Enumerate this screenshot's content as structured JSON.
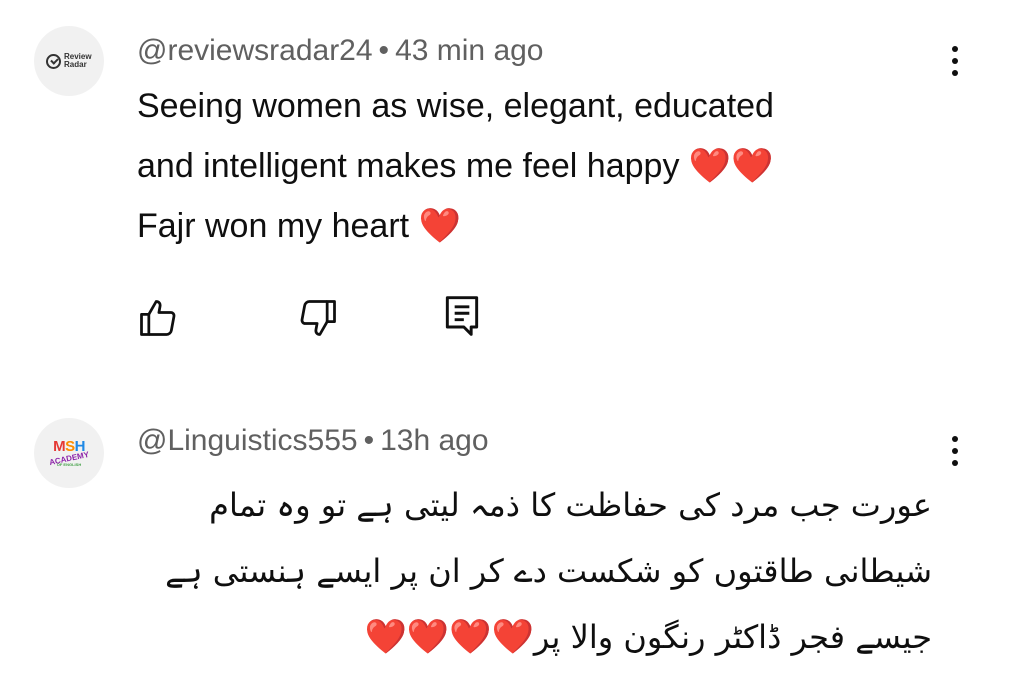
{
  "comments": [
    {
      "avatar": {
        "icon": "review-radar-logo",
        "text_line1": "Review",
        "text_line2": "Radar"
      },
      "author": "@reviewsradar24",
      "separator": "•",
      "time": "43 min ago",
      "lines": [
        "Seeing women as wise, elegant, educated",
        "and intelligent makes me feel happy",
        "Fajr won my heart"
      ],
      "hearts": [
        "❤️❤️",
        "❤️"
      ],
      "actions": {
        "like_icon": "thumbs-up-icon",
        "dislike_icon": "thumbs-down-icon",
        "reply_icon": "reply-comment-icon"
      },
      "menu_icon": "more-vert-icon"
    },
    {
      "avatar": {
        "icon": "mh-academy-logo",
        "m": "M",
        "s": "S",
        "h": "H",
        "sub": "ACADEMY",
        "tiny": "OF ENGLISH"
      },
      "author": "@Linguistics555",
      "separator": "•",
      "time": "13h ago",
      "lines": [
        "عورت جب مرد کی حفاظت کا ذمہ لیتی ہے تو وہ تمام",
        "شیطانی طاقتوں کو شکست دے کر ان پر ایسے ہنستی ہے",
        "جیسے فجر ڈاکٹر رنگون والا پر"
      ],
      "hearts": [
        "❤️❤️❤️❤️"
      ],
      "menu_icon": "more-vert-icon"
    }
  ],
  "colors": {
    "text": "#0f0f0f",
    "meta": "#606060",
    "heart": "#e3262f",
    "avatar_bg": "#f1f1f1"
  }
}
